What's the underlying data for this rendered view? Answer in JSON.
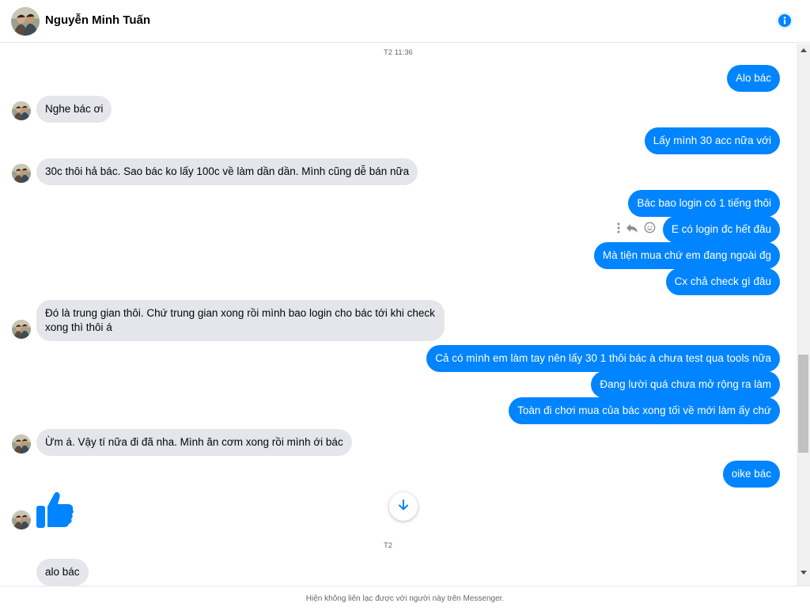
{
  "header": {
    "contact_name": "Nguyễn Minh Tuấn",
    "info_icon": "info-circle-icon"
  },
  "thread": {
    "timestamp_top": "T2 11:36",
    "timestamp_bottom": "T2",
    "messages": [
      {
        "from": "me",
        "text": "Alo bác"
      },
      {
        "from": "them",
        "text": "Nghe bác ơi"
      },
      {
        "from": "me",
        "text": "Lấy mình 30 acc nữa với"
      },
      {
        "from": "them",
        "text": "30c thôi hả bác. Sao bác ko lấy 100c về làm dần dần. Mình cũng dễ bán nữa"
      },
      {
        "from": "me",
        "text": "Bác bao login có 1 tiếng thôi"
      },
      {
        "from": "me",
        "text": "E có login đc hết đâu"
      },
      {
        "from": "me",
        "text": "Mà tiện mua chứ em đang ngoài đg"
      },
      {
        "from": "me",
        "text": "Cx chả check gì đâu"
      },
      {
        "from": "them",
        "text": "Đó là trung gian thôi. Chứ trung gian xong rồi mình bao login cho bác tới khi check xong thì thôi á"
      },
      {
        "from": "me",
        "text": "Cả có mình em làm tay nên lấy 30 1 thôi bác à chưa test qua tools nữa"
      },
      {
        "from": "me",
        "text": "Đang lười quá chưa mở rộng ra làm"
      },
      {
        "from": "me",
        "text": "Toàn đi chơi mua của bác xong tối về mới làm ấy chứ"
      },
      {
        "from": "them",
        "text": "Ừm á. Vậy tí nữa đi đã nha. Mình ăn cơm xong rồi mình ới bác"
      },
      {
        "from": "me",
        "text": "oike bác"
      },
      {
        "from": "them",
        "text": "alo bác"
      }
    ],
    "message_action_icons": [
      "more-vertical-icon",
      "reply-icon",
      "react-smiley-icon"
    ],
    "like_icon": "thumbs-up-icon",
    "scroll_down_icon": "arrow-down-icon"
  },
  "footer": {
    "notice": "Hiện không liên lạc được với người này trên Messenger."
  },
  "colors": {
    "accent": "#0084ff",
    "incoming_bubble": "#e4e6eb",
    "text": "#050505",
    "secondary_text": "#65676b"
  }
}
